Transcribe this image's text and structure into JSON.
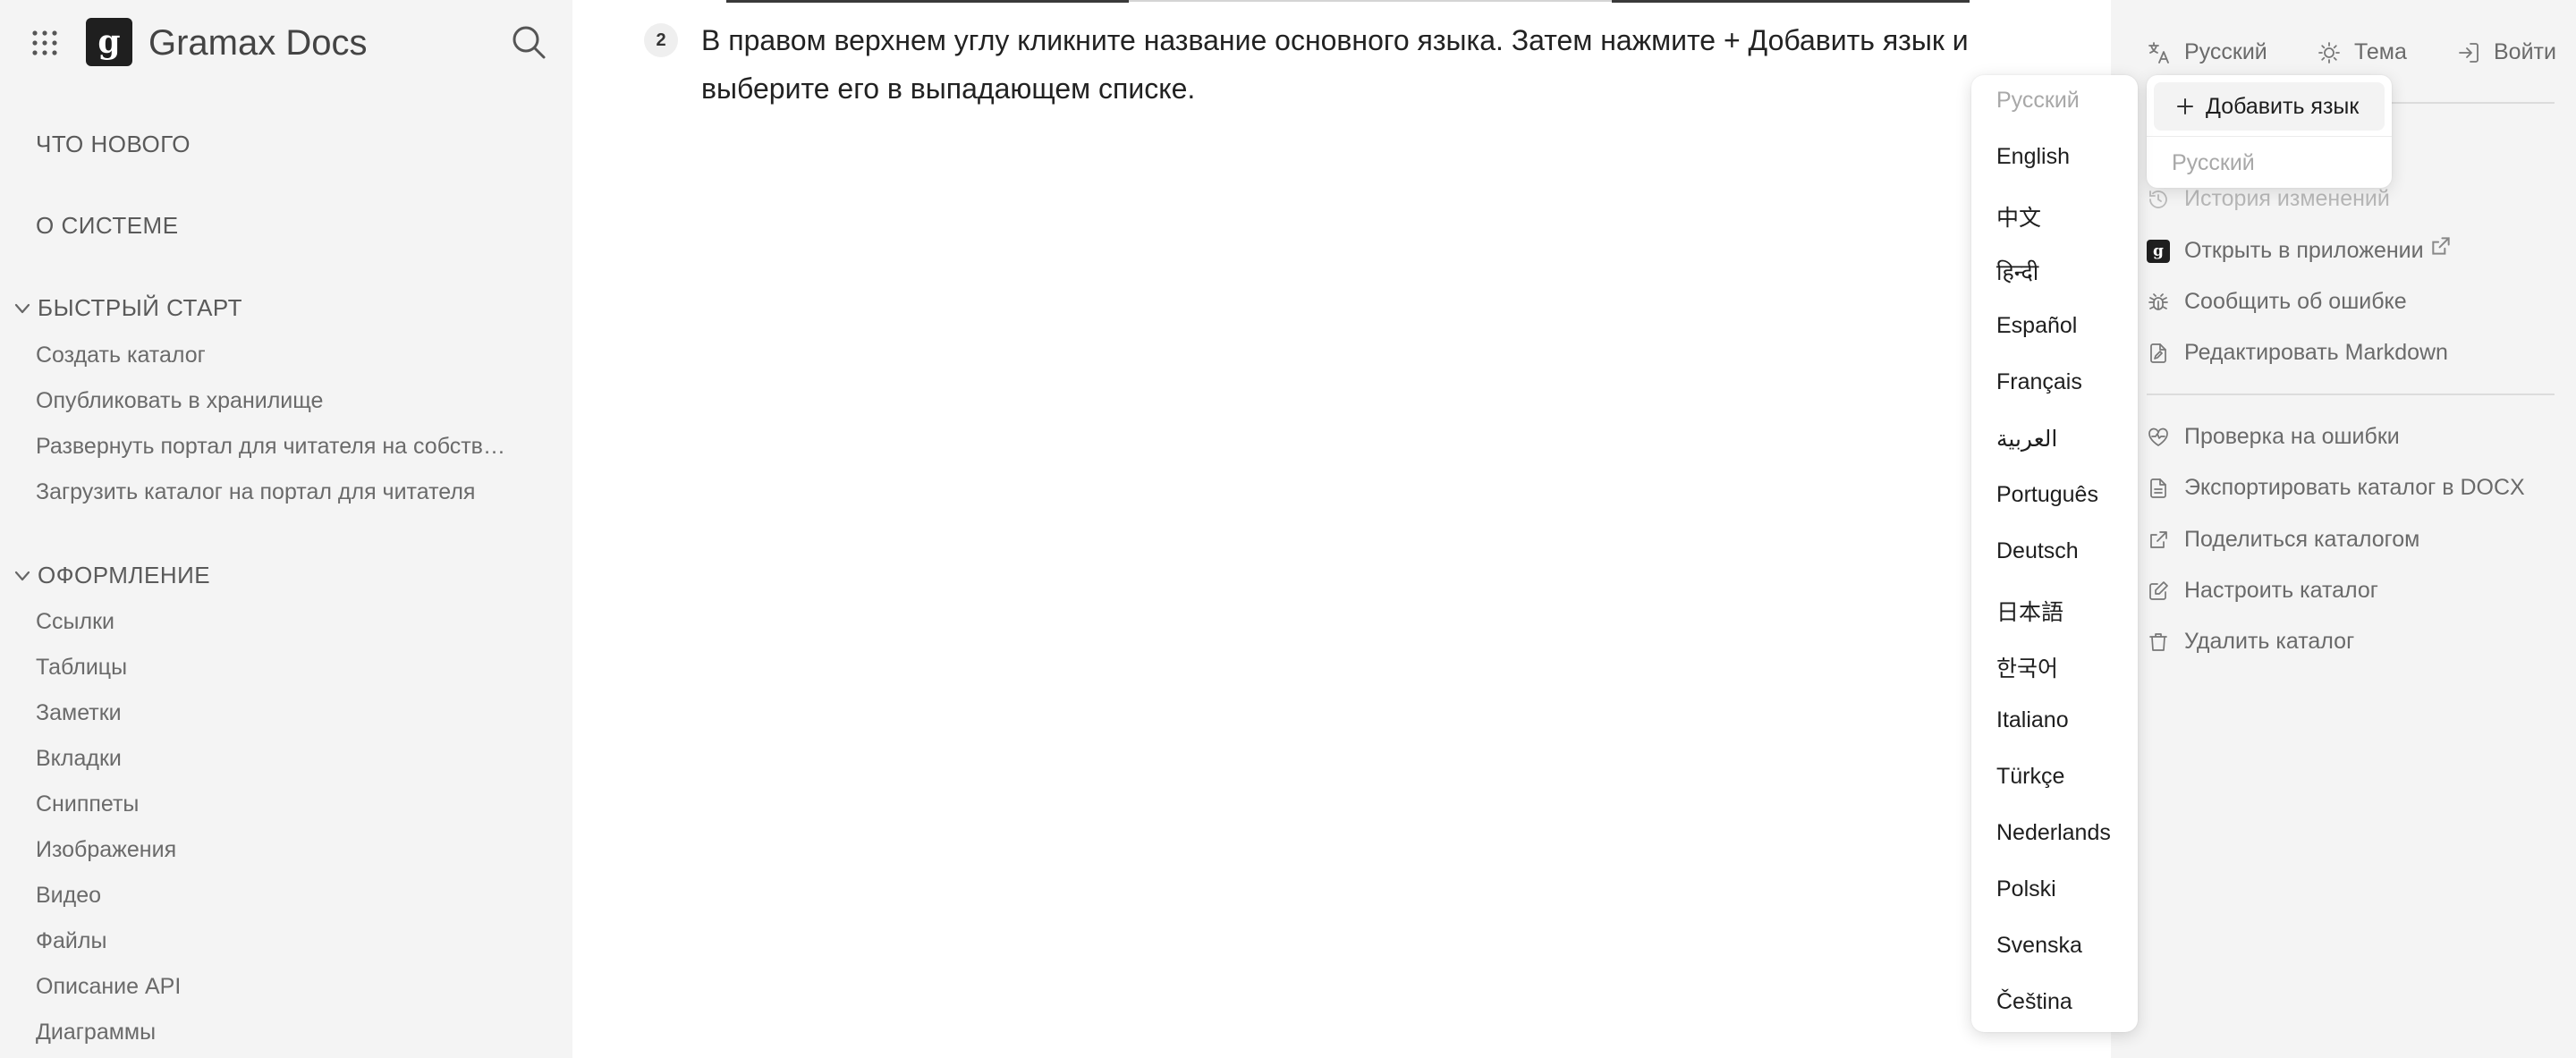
{
  "app": {
    "title": "Gramax Docs",
    "logo_letter": "g"
  },
  "icons": {
    "apps": "apps-grid-icon",
    "search": "search-icon",
    "chevron": "chevron-down-icon",
    "language": "language-icon",
    "theme": "sun-icon",
    "login": "login-icon",
    "plus": "plus-icon"
  },
  "sidebar": {
    "whats_new": "ЧТО НОВОГО",
    "about": "О СИСТЕМЕ",
    "groups": [
      {
        "title": "БЫСТРЫЙ СТАРТ",
        "items": [
          "Создать каталог",
          "Опубликовать в хранилище",
          "Развернуть портал для читателя на собств…",
          "Загрузить каталог на портал для читателя"
        ]
      },
      {
        "title": "ОФОРМЛЕНИЕ",
        "items": [
          "Ссылки",
          "Таблицы",
          "Заметки",
          "Вкладки",
          "Сниппеты",
          "Изображения",
          "Видео",
          "Файлы",
          "Описание API",
          "Диаграммы"
        ]
      }
    ]
  },
  "content": {
    "step_number": "2",
    "step_text": "В правом верхнем углу кликните название основного языка. Затем нажмите + Добавить язык и выберите его в выпадающем списке."
  },
  "topbar": {
    "language": "Русский",
    "theme": "Тема",
    "login": "Войти"
  },
  "add_language_popover": {
    "add_label": "Добавить язык",
    "current_language": "Русский"
  },
  "language_menu": {
    "current": "Русский",
    "options": [
      "English",
      "中文",
      "हिन्दी",
      "Español",
      "Français",
      "العربية",
      "Português",
      "Deutsch",
      "日本語",
      "한국어",
      "Italiano",
      "Türkçe",
      "Nederlands",
      "Polski",
      "Svenska",
      "Čeština"
    ]
  },
  "actions": {
    "history": "История изменений",
    "open_in_app": "Открыть в приложении",
    "report_bug": "Сообщить об ошибке",
    "edit_markdown": "Редактировать Markdown",
    "check_errors": "Проверка на ошибки",
    "export_docx": "Экспортировать каталог в DOCX",
    "share_catalog": "Поделиться каталогом",
    "configure_catalog": "Настроить каталог",
    "delete_catalog": "Удалить каталог"
  }
}
